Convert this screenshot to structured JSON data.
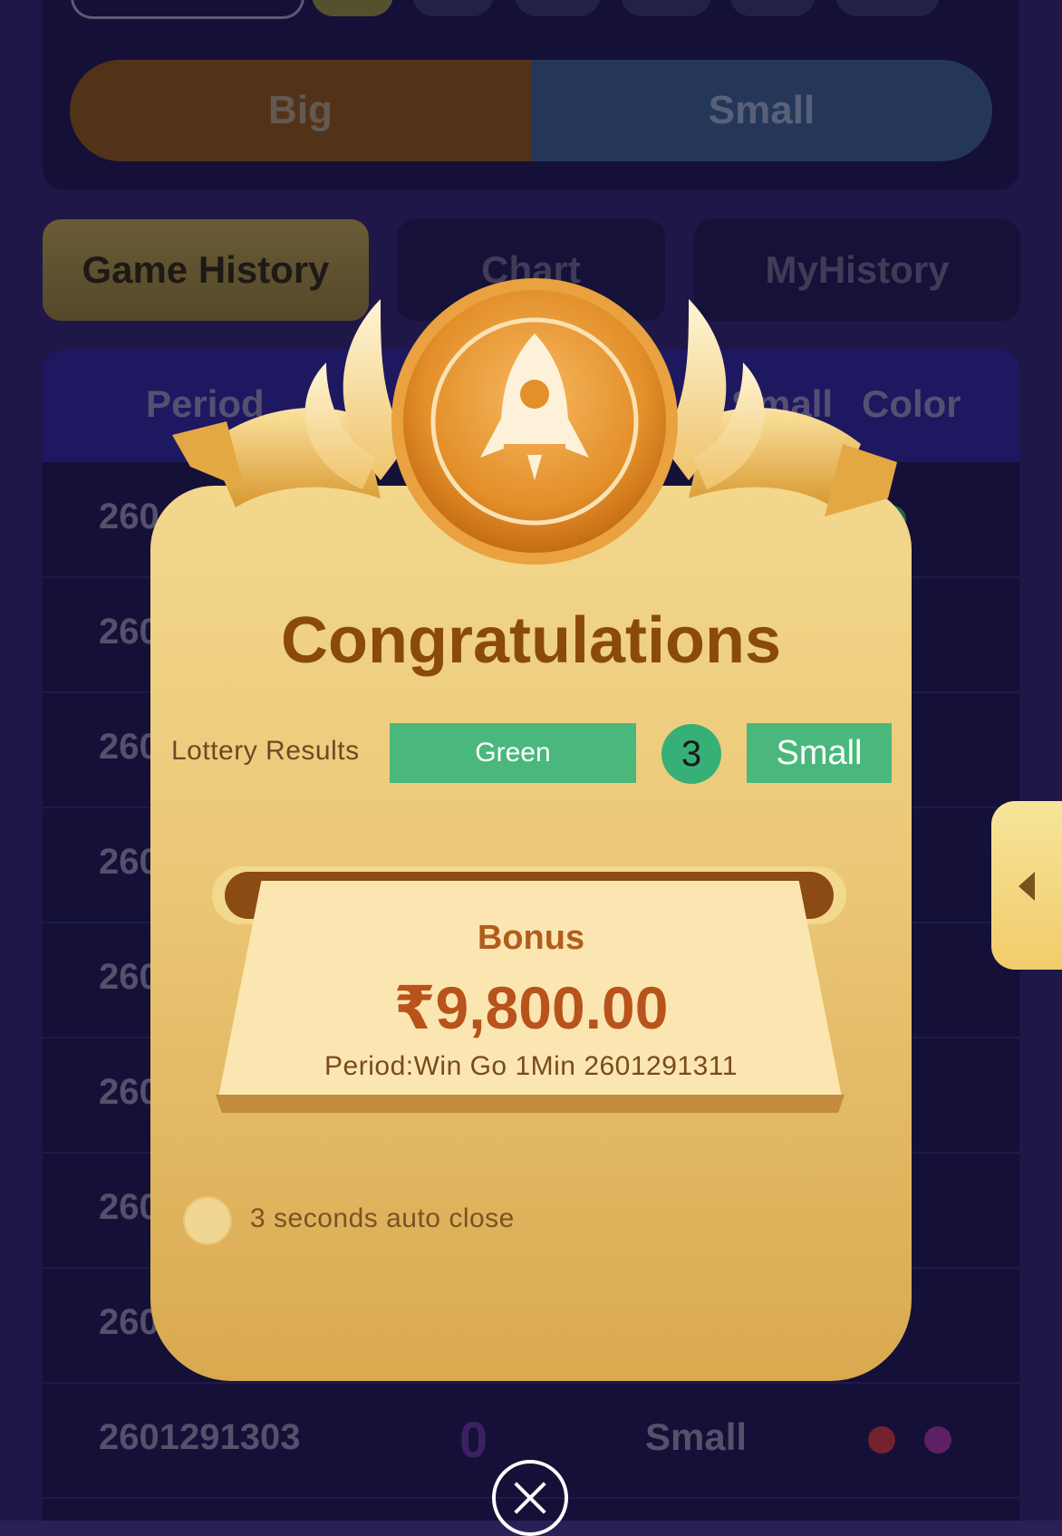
{
  "bet_options": {
    "big_label": "Big",
    "small_label": "Small"
  },
  "tabs": [
    {
      "label": "Game History",
      "active": true
    },
    {
      "label": "Chart",
      "active": false
    },
    {
      "label": "MyHistory",
      "active": false
    }
  ],
  "table": {
    "headers": {
      "period": "Period",
      "big_small": "Small",
      "color": "Color"
    },
    "rows": [
      {
        "period": "260",
        "dots": [
          "#2f9c5e"
        ]
      },
      {
        "period": "260",
        "dots": [
          "#2f9c5e"
        ]
      },
      {
        "period": "260",
        "dots": [
          "#8b2f8b"
        ]
      },
      {
        "period": "260",
        "dots": [
          "#2f9c5e"
        ]
      },
      {
        "period": "260",
        "dots": [
          "#2f9c5e"
        ]
      },
      {
        "period": "260",
        "dots": [
          "#b0323a"
        ]
      },
      {
        "period": "260",
        "dots": [
          "#2f9c5e"
        ]
      },
      {
        "period": "260",
        "dots": [
          "#2f9c5e"
        ]
      },
      {
        "period": "2601291303",
        "number": "0",
        "size": "Small",
        "dots": [
          "#b0323a",
          "#8b2f8b"
        ]
      }
    ]
  },
  "modal": {
    "title": "Congratulations",
    "lottery_label": "Lottery Results",
    "result_color": "Green",
    "result_number": "3",
    "result_size": "Small",
    "bonus_label": "Bonus",
    "bonus_amount": "₹9,800.00",
    "period_text": "Period:Win Go 1Min 2601291311",
    "auto_close_text": "3 seconds auto close"
  },
  "colors": {
    "background": "#2b2160",
    "modal_gold": "#ecc979",
    "result_green": "#4ab87c",
    "bonus_text": "#b8531b"
  },
  "icons": [
    "rocket-icon",
    "close-icon",
    "chevron-left-icon"
  ]
}
